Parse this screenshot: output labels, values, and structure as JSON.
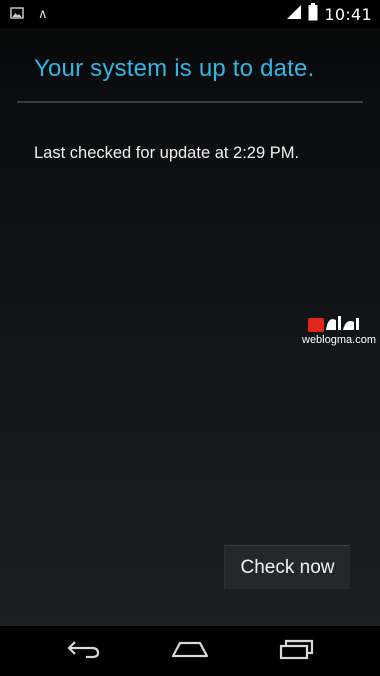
{
  "status_bar": {
    "time": "10:41",
    "left_icons": [
      "image-notification-icon",
      "caret-up-icon"
    ],
    "right_icons": [
      "signal-icon",
      "battery-icon"
    ]
  },
  "main": {
    "title": "Your system is up to date.",
    "last_checked": "Last checked for update at 2:29 PM.",
    "check_button_label": "Check now"
  },
  "watermark": {
    "text": "weblogma.com"
  },
  "nav_bar": {
    "buttons": [
      "back-icon",
      "home-icon",
      "recent-apps-icon"
    ]
  },
  "colors": {
    "accent": "#33b5e5",
    "background": "#000000",
    "text": "#f0f0f0"
  }
}
